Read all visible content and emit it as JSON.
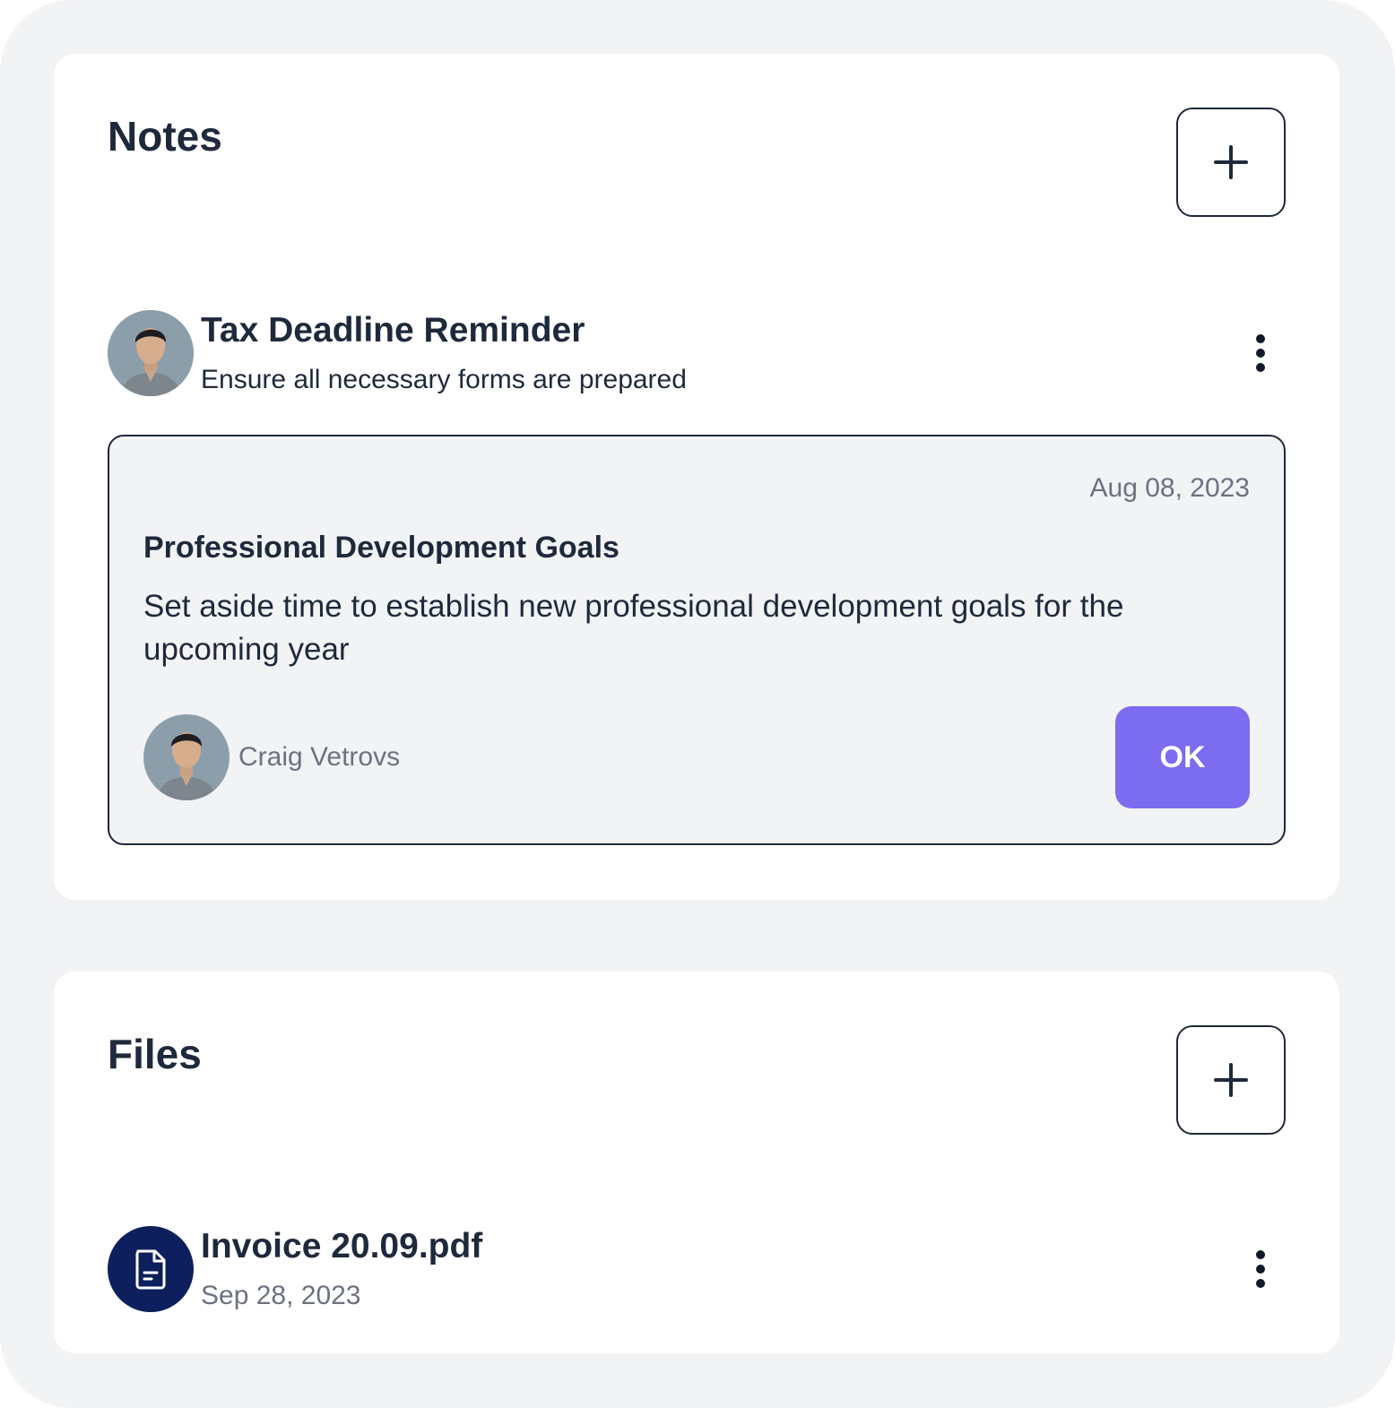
{
  "notes": {
    "title": "Notes",
    "add_icon": "plus-icon",
    "item": {
      "title": "Tax Deadline Reminder",
      "subtitle": "Ensure all necessary forms are prepared",
      "menu_icon": "more-vertical-icon"
    },
    "note_card": {
      "date": "Aug 08, 2023",
      "title": "Professional Development Goals",
      "body": "Set aside time to establish new professional development goals for the upcoming year",
      "author": "Craig Vetrovs",
      "ok_label": "OK",
      "accent_color": "#7b6cf0"
    }
  },
  "files": {
    "title": "Files",
    "add_icon": "plus-icon",
    "item": {
      "name": "Invoice 20.09.pdf",
      "date": "Sep 28, 2023",
      "icon": "document-icon",
      "icon_bg_color": "#0d1f5c",
      "menu_icon": "more-vertical-icon"
    }
  }
}
